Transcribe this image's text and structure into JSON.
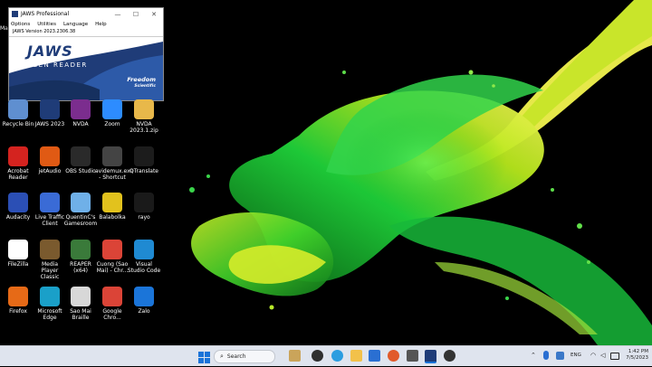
{
  "jaws_window": {
    "title": "JAWS Professional",
    "menu": [
      "Options",
      "Utilities",
      "Language",
      "Help"
    ],
    "version": "JAWS Version 2023.2306.38",
    "logo_text": "JAWS",
    "logo_subtitle": "SCREEN READER",
    "brand_line1": "Freedom",
    "brand_line2": "Scientific",
    "minimize": "—",
    "maximize": "☐",
    "close": "✕"
  },
  "desktop_icons": [
    {
      "label": "Recycle Bin",
      "icon": "recycle-bin-icon",
      "color": "#5f8fd0"
    },
    {
      "label": "JAWS 2023",
      "icon": "jaws-shark-icon",
      "color": "#1f3c78"
    },
    {
      "label": "NVDA",
      "icon": "nvda-icon",
      "color": "#7b2d8e"
    },
    {
      "label": "Zoom",
      "icon": "zoom-icon",
      "color": "#2d8cff"
    },
    {
      "label": "NVDA 2023.1.zip",
      "icon": "zip-folder-icon",
      "color": "#e8b84a"
    },
    {
      "label": "Acrobat Reader",
      "icon": "acrobat-icon",
      "color": "#d4231f"
    },
    {
      "label": "jetAudio",
      "icon": "jetaudio-icon",
      "color": "#e05a14"
    },
    {
      "label": "OBS Studio",
      "icon": "obs-icon",
      "color": "#2a2a2a"
    },
    {
      "label": "avidemux.exe - Shortcut",
      "icon": "avidemux-icon",
      "color": "#444444"
    },
    {
      "label": "QTranslate",
      "icon": "qtranslate-icon",
      "color": "#1c1c1c"
    },
    {
      "label": "Audacity",
      "icon": "audacity-icon",
      "color": "#2b4fb5"
    },
    {
      "label": "Live Traffic Client",
      "icon": "live-traffic-icon",
      "color": "#3a6bd6"
    },
    {
      "label": "QuentinC's Gamesroom",
      "icon": "gamesroom-icon",
      "color": "#6fb0e8"
    },
    {
      "label": "Balabolka",
      "icon": "balabolka-icon",
      "color": "#e2c21d"
    },
    {
      "label": "rayo",
      "icon": "rayo-icon",
      "color": "#1a1a1a"
    },
    {
      "label": "FileZilla",
      "icon": "filezilla-icon",
      "color": "#ffffff"
    },
    {
      "label": "Media Player Classic",
      "icon": "mpc-icon",
      "color": "#7a5a2e"
    },
    {
      "label": "REAPER (x64)",
      "icon": "reaper-icon",
      "color": "#3a7a3a"
    },
    {
      "label": "Cuong (Sao Mai) - Chr...",
      "icon": "chrome-icon",
      "color": "#db4437"
    },
    {
      "label": "Visual Studio Code",
      "icon": "vscode-icon",
      "color": "#1f8ad2"
    },
    {
      "label": "Firefox",
      "icon": "firefox-icon",
      "color": "#e66a17"
    },
    {
      "label": "Microsoft Edge",
      "icon": "edge-icon",
      "color": "#1aa0c9"
    },
    {
      "label": "Sao Mai Braille",
      "icon": "printer-icon",
      "color": "#d8d8d8"
    },
    {
      "label": "Google Chro...",
      "icon": "chrome-icon",
      "color": "#db4437"
    },
    {
      "label": "Zalo",
      "icon": "zalo-icon",
      "color": "#1b75d9"
    }
  ],
  "partial_icon_label": "Ma",
  "taskbar": {
    "search_placeholder": "Search",
    "language": "ENG",
    "time": "1:42 PM",
    "date": "7/5/2023"
  },
  "colors": {
    "taskbar": "#dfe4ee",
    "jaws_blue": "#1f3c78",
    "splash_green": "#22c42a",
    "splash_yellow": "#d7e81a"
  }
}
